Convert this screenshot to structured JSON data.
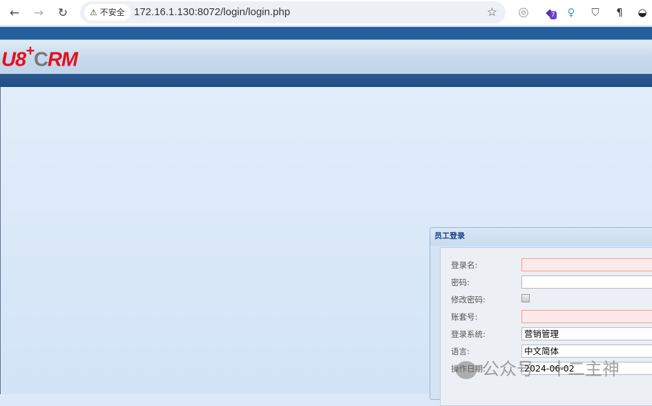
{
  "browser": {
    "security_label": "不安全",
    "url": "172.16.1.130:8072/login/login.php",
    "extension_badge": "7"
  },
  "header": {
    "logo_text": "U8+CRM",
    "logo_red": "U8",
    "logo_plus": "+",
    "logo_gray": "C",
    "logo_red2": "RM"
  },
  "dialog": {
    "title": "员工登录",
    "fields": [
      {
        "label": "登录名:",
        "value": "",
        "type": "text",
        "required": true
      },
      {
        "label": "密码:",
        "value": "",
        "type": "password",
        "required": false
      },
      {
        "label": "修改密码:",
        "checked": false,
        "type": "checkbox"
      },
      {
        "label": "账套号:",
        "value": "",
        "type": "text",
        "required": true
      },
      {
        "label": "登录系统:",
        "value": "营销管理",
        "type": "select"
      },
      {
        "label": "语言:",
        "value": "中文简体",
        "type": "select"
      },
      {
        "label": "操作日期:",
        "value": "2024-06-02",
        "type": "date"
      }
    ]
  },
  "watermark": "公众号 · 十二主神",
  "colors": {
    "brand_red": "#e3111c",
    "band_blue": "#245e9c",
    "required_bg": "#fde9e9"
  }
}
